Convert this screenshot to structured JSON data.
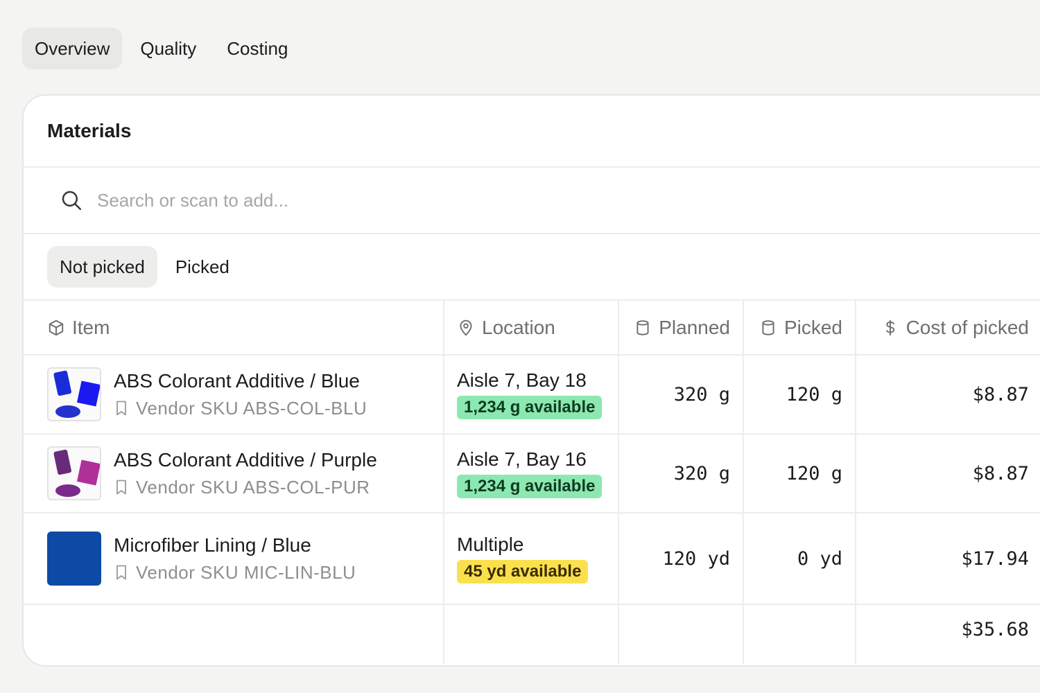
{
  "tabs": [
    {
      "label": "Overview",
      "active": true
    },
    {
      "label": "Quality",
      "active": false
    },
    {
      "label": "Costing",
      "active": false
    }
  ],
  "materials": {
    "title": "Materials",
    "search": {
      "placeholder": "Search or scan to add...",
      "value": ""
    },
    "filters": [
      {
        "label": "Not picked",
        "active": true
      },
      {
        "label": "Picked",
        "active": false
      }
    ],
    "columns": {
      "item": "Item",
      "location": "Location",
      "planned": "Planned",
      "picked": "Picked",
      "cost": "Cost of picked"
    },
    "rows": [
      {
        "name": "ABS Colorant Additive / Blue",
        "sku": "Vendor SKU ABS-COL-BLU",
        "location": "Aisle 7, Bay 18",
        "availability": "1,234 g available",
        "planned": "320 g",
        "picked": "120 g",
        "cost": "$8.87",
        "thumb_color": "#1a2bd8",
        "badge_color": "#8ce8b0"
      },
      {
        "name": "ABS Colorant Additive / Purple",
        "sku": "Vendor SKU ABS-COL-PUR",
        "location": "Aisle 7, Bay 16",
        "availability": "1,234 g available",
        "planned": "320 g",
        "picked": "120 g",
        "cost": "$8.87",
        "thumb_color": "#8a2f9a",
        "badge_color": "#8ce8b0"
      },
      {
        "name": "Microfiber Lining / Blue",
        "sku": "Vendor SKU MIC-LIN-BLU",
        "location": "Multiple",
        "availability": "45 yd available",
        "planned": "120 yd",
        "picked": "0 yd",
        "cost": "$17.94",
        "thumb_color": "#0c4aa6",
        "badge_color": "#fbe04d"
      }
    ],
    "total_cost": "$35.68"
  }
}
